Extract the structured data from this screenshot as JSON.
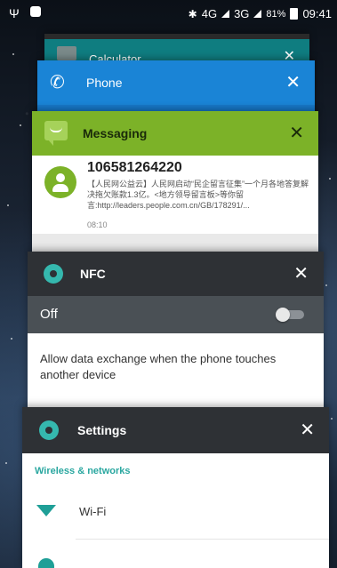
{
  "status_bar": {
    "usb_icon": "usb-icon",
    "notification_icon": "notification-icon",
    "bluetooth_icon": "bluetooth-icon",
    "network_4g": "4G",
    "network_3g": "3G",
    "battery_percent": "81%",
    "time": "09:41"
  },
  "recents": {
    "calculator": {
      "title": "Calculator",
      "icon": "calculator-icon",
      "close": "✕",
      "color": "#0f7d80"
    },
    "phone": {
      "title": "Phone",
      "icon": "phone-icon",
      "close": "✕",
      "color": "#1a84d6"
    },
    "messaging": {
      "title": "Messaging",
      "icon": "messaging-icon",
      "close": "✕",
      "color": "#7cb228",
      "sender": "106581264220",
      "message": "【人民网公益云】人民网启动“民企留言征集”一个月各地答复解决拖欠账款1.3亿。<地方领导留言板>等你留言:http://leaders.people.com.cn/GB/178291/...",
      "time": "08:10"
    },
    "nfc": {
      "title": "NFC",
      "icon": "gear-icon",
      "close": "✕",
      "toggle_label": "Off",
      "toggle_on": false,
      "description": "Allow data exchange when the phone touches another device"
    },
    "settings": {
      "title": "Settings",
      "icon": "gear-icon",
      "close": "✕",
      "section": "Wireless & networks",
      "first_item": "Wi-Fi",
      "accent": "#2aa7a0"
    }
  }
}
